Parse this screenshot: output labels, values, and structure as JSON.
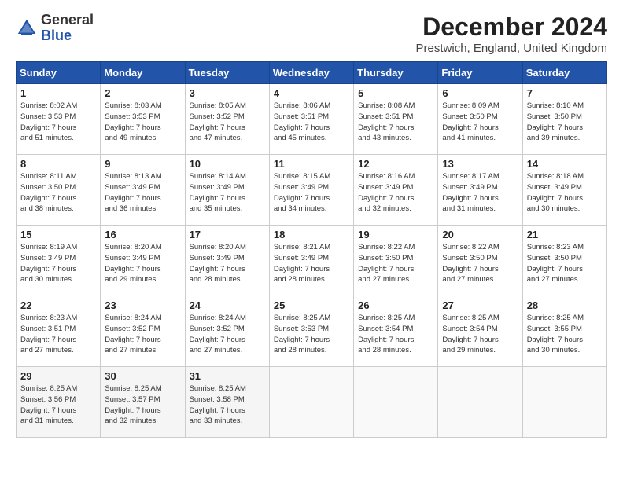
{
  "header": {
    "logo_line1": "General",
    "logo_line2": "Blue",
    "title": "December 2024",
    "subtitle": "Prestwich, England, United Kingdom"
  },
  "weekdays": [
    "Sunday",
    "Monday",
    "Tuesday",
    "Wednesday",
    "Thursday",
    "Friday",
    "Saturday"
  ],
  "weeks": [
    [
      {
        "day": "1",
        "info": "Sunrise: 8:02 AM\nSunset: 3:53 PM\nDaylight: 7 hours\nand 51 minutes."
      },
      {
        "day": "2",
        "info": "Sunrise: 8:03 AM\nSunset: 3:53 PM\nDaylight: 7 hours\nand 49 minutes."
      },
      {
        "day": "3",
        "info": "Sunrise: 8:05 AM\nSunset: 3:52 PM\nDaylight: 7 hours\nand 47 minutes."
      },
      {
        "day": "4",
        "info": "Sunrise: 8:06 AM\nSunset: 3:51 PM\nDaylight: 7 hours\nand 45 minutes."
      },
      {
        "day": "5",
        "info": "Sunrise: 8:08 AM\nSunset: 3:51 PM\nDaylight: 7 hours\nand 43 minutes."
      },
      {
        "day": "6",
        "info": "Sunrise: 8:09 AM\nSunset: 3:50 PM\nDaylight: 7 hours\nand 41 minutes."
      },
      {
        "day": "7",
        "info": "Sunrise: 8:10 AM\nSunset: 3:50 PM\nDaylight: 7 hours\nand 39 minutes."
      }
    ],
    [
      {
        "day": "8",
        "info": "Sunrise: 8:11 AM\nSunset: 3:50 PM\nDaylight: 7 hours\nand 38 minutes."
      },
      {
        "day": "9",
        "info": "Sunrise: 8:13 AM\nSunset: 3:49 PM\nDaylight: 7 hours\nand 36 minutes."
      },
      {
        "day": "10",
        "info": "Sunrise: 8:14 AM\nSunset: 3:49 PM\nDaylight: 7 hours\nand 35 minutes."
      },
      {
        "day": "11",
        "info": "Sunrise: 8:15 AM\nSunset: 3:49 PM\nDaylight: 7 hours\nand 34 minutes."
      },
      {
        "day": "12",
        "info": "Sunrise: 8:16 AM\nSunset: 3:49 PM\nDaylight: 7 hours\nand 32 minutes."
      },
      {
        "day": "13",
        "info": "Sunrise: 8:17 AM\nSunset: 3:49 PM\nDaylight: 7 hours\nand 31 minutes."
      },
      {
        "day": "14",
        "info": "Sunrise: 8:18 AM\nSunset: 3:49 PM\nDaylight: 7 hours\nand 30 minutes."
      }
    ],
    [
      {
        "day": "15",
        "info": "Sunrise: 8:19 AM\nSunset: 3:49 PM\nDaylight: 7 hours\nand 30 minutes."
      },
      {
        "day": "16",
        "info": "Sunrise: 8:20 AM\nSunset: 3:49 PM\nDaylight: 7 hours\nand 29 minutes."
      },
      {
        "day": "17",
        "info": "Sunrise: 8:20 AM\nSunset: 3:49 PM\nDaylight: 7 hours\nand 28 minutes."
      },
      {
        "day": "18",
        "info": "Sunrise: 8:21 AM\nSunset: 3:49 PM\nDaylight: 7 hours\nand 28 minutes."
      },
      {
        "day": "19",
        "info": "Sunrise: 8:22 AM\nSunset: 3:50 PM\nDaylight: 7 hours\nand 27 minutes."
      },
      {
        "day": "20",
        "info": "Sunrise: 8:22 AM\nSunset: 3:50 PM\nDaylight: 7 hours\nand 27 minutes."
      },
      {
        "day": "21",
        "info": "Sunrise: 8:23 AM\nSunset: 3:50 PM\nDaylight: 7 hours\nand 27 minutes."
      }
    ],
    [
      {
        "day": "22",
        "info": "Sunrise: 8:23 AM\nSunset: 3:51 PM\nDaylight: 7 hours\nand 27 minutes."
      },
      {
        "day": "23",
        "info": "Sunrise: 8:24 AM\nSunset: 3:52 PM\nDaylight: 7 hours\nand 27 minutes."
      },
      {
        "day": "24",
        "info": "Sunrise: 8:24 AM\nSunset: 3:52 PM\nDaylight: 7 hours\nand 27 minutes."
      },
      {
        "day": "25",
        "info": "Sunrise: 8:25 AM\nSunset: 3:53 PM\nDaylight: 7 hours\nand 28 minutes."
      },
      {
        "day": "26",
        "info": "Sunrise: 8:25 AM\nSunset: 3:54 PM\nDaylight: 7 hours\nand 28 minutes."
      },
      {
        "day": "27",
        "info": "Sunrise: 8:25 AM\nSunset: 3:54 PM\nDaylight: 7 hours\nand 29 minutes."
      },
      {
        "day": "28",
        "info": "Sunrise: 8:25 AM\nSunset: 3:55 PM\nDaylight: 7 hours\nand 30 minutes."
      }
    ],
    [
      {
        "day": "29",
        "info": "Sunrise: 8:25 AM\nSunset: 3:56 PM\nDaylight: 7 hours\nand 31 minutes."
      },
      {
        "day": "30",
        "info": "Sunrise: 8:25 AM\nSunset: 3:57 PM\nDaylight: 7 hours\nand 32 minutes."
      },
      {
        "day": "31",
        "info": "Sunrise: 8:25 AM\nSunset: 3:58 PM\nDaylight: 7 hours\nand 33 minutes."
      },
      {
        "day": "",
        "info": ""
      },
      {
        "day": "",
        "info": ""
      },
      {
        "day": "",
        "info": ""
      },
      {
        "day": "",
        "info": ""
      }
    ]
  ]
}
